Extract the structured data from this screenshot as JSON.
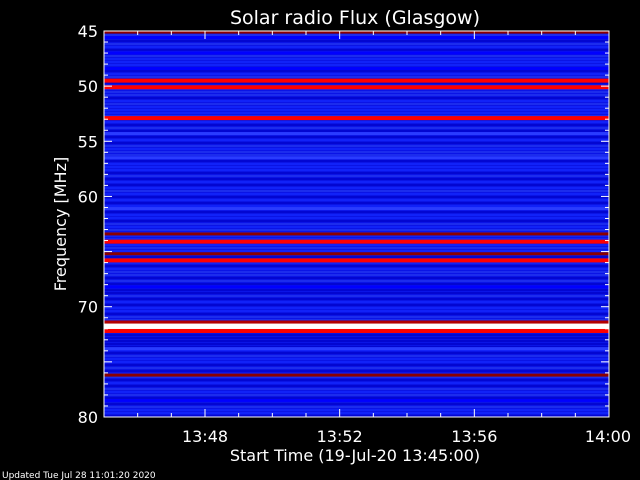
{
  "chart_data": {
    "type": "heatmap",
    "title": "Solar radio Flux (Glasgow)",
    "xlabel": "Start Time (19-Jul-20 13:45:00)",
    "ylabel": "Frequency [MHz]",
    "footer": "Updated Tue Jul 28 11:01:20 2020",
    "x_range_minutes": [
      0,
      15
    ],
    "x_ticks": [
      {
        "minute": 3,
        "label": "13:48"
      },
      {
        "minute": 7,
        "label": "13:52"
      },
      {
        "minute": 11,
        "label": "13:56"
      },
      {
        "minute": 15,
        "label": "14:00"
      }
    ],
    "y_range_mhz": [
      45,
      80
    ],
    "y_inverted": true,
    "y_ticks": [
      45,
      50,
      55,
      60,
      65,
      70,
      75,
      80
    ],
    "y_tick_labels": [
      "45",
      "50",
      "55",
      "60",
      "",
      "70",
      "",
      "80"
    ],
    "colormap": [
      "#00008b",
      "#0000ff",
      "#2a3cff",
      "#8b0000",
      "#ff0000",
      "#ffff00",
      "#ffffff"
    ],
    "bands": [
      {
        "mhz": 45.1,
        "intensity": 0.45
      },
      {
        "mhz": 45.6,
        "intensity": 0.25
      },
      {
        "mhz": 47.0,
        "intensity": 0.2
      },
      {
        "mhz": 48.4,
        "intensity": 0.2
      },
      {
        "mhz": 49.5,
        "intensity": 0.62
      },
      {
        "mhz": 50.1,
        "intensity": 0.72
      },
      {
        "mhz": 52.9,
        "intensity": 0.6
      },
      {
        "mhz": 54.3,
        "intensity": 0.3
      },
      {
        "mhz": 56.5,
        "intensity": 0.3
      },
      {
        "mhz": 61.1,
        "intensity": 0.3
      },
      {
        "mhz": 63.4,
        "intensity": 0.5
      },
      {
        "mhz": 64.1,
        "intensity": 0.7
      },
      {
        "mhz": 65.2,
        "intensity": 0.55
      },
      {
        "mhz": 65.8,
        "intensity": 0.62
      },
      {
        "mhz": 68.2,
        "intensity": 0.25
      },
      {
        "mhz": 71.4,
        "intensity": 0.55
      },
      {
        "mhz": 71.8,
        "intensity": 1.0
      },
      {
        "mhz": 72.2,
        "intensity": 0.6
      },
      {
        "mhz": 73.8,
        "intensity": 0.35
      },
      {
        "mhz": 76.2,
        "intensity": 0.55
      },
      {
        "mhz": 78.5,
        "intensity": 0.2
      }
    ]
  }
}
